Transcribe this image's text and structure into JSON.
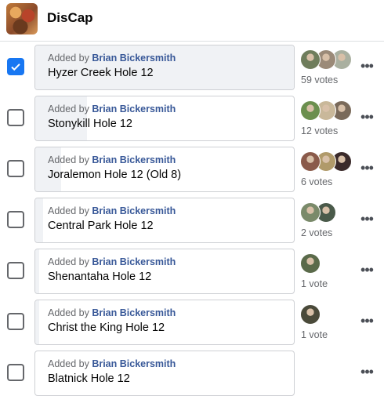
{
  "group": {
    "name": "DisCap"
  },
  "poll": {
    "added_by_prefix": "Added by",
    "options": [
      {
        "author": "Brian Bickersmith",
        "name": "Hyzer Creek Hole 12",
        "votes_label": "59 votes",
        "checked": true,
        "share": 1.0,
        "avatars": [
          {
            "color": "#6f7d5c"
          },
          {
            "color": "#9b8a78"
          },
          {
            "color": "#aab0a0"
          }
        ]
      },
      {
        "author": "Brian Bickersmith",
        "name": "Stonykill Hole 12",
        "votes_label": "12 votes",
        "checked": false,
        "share": 0.2,
        "avatars": [
          {
            "color": "#6b8f4e"
          },
          {
            "color": "#c9b89a"
          },
          {
            "color": "#7a6a5a"
          }
        ]
      },
      {
        "author": "Brian Bickersmith",
        "name": "Joralemon Hole 12 (Old 8)",
        "votes_label": "6 votes",
        "checked": false,
        "share": 0.1,
        "avatars": [
          {
            "color": "#8a5a4a"
          },
          {
            "color": "#b09a6a"
          },
          {
            "color": "#3a2a2a"
          }
        ]
      },
      {
        "author": "Brian Bickersmith",
        "name": "Central Park Hole 12",
        "votes_label": "2 votes",
        "checked": false,
        "share": 0.03,
        "avatars": [
          {
            "color": "#7a8a6a"
          },
          {
            "color": "#4a5a4a"
          }
        ]
      },
      {
        "author": "Brian Bickersmith",
        "name": "Shenantaha Hole 12",
        "votes_label": "1 vote",
        "checked": false,
        "share": 0.015,
        "avatars": [
          {
            "color": "#5a6a4a"
          }
        ]
      },
      {
        "author": "Brian Bickersmith",
        "name": "Christ the King Hole 12",
        "votes_label": "1 vote",
        "checked": false,
        "share": 0.015,
        "avatars": [
          {
            "color": "#4a4a3a"
          }
        ]
      },
      {
        "author": "Brian Bickersmith",
        "name": "Blatnick Hole 12",
        "votes_label": "",
        "checked": false,
        "share": 0.0,
        "avatars": []
      }
    ]
  },
  "more_icon": "more-horizontal-icon",
  "accent_color": "#1877f2"
}
